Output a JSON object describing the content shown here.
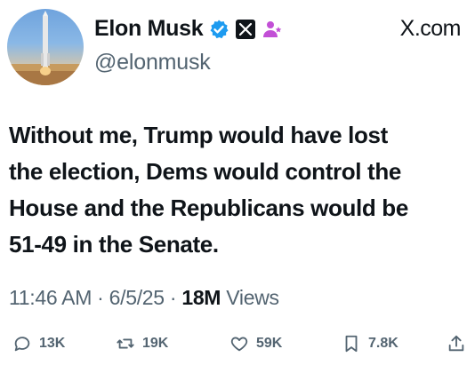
{
  "profile": {
    "display_name": "Elon Musk",
    "handle": "@elonmusk",
    "brand": "X.com"
  },
  "tweet": {
    "lines": [
      "Without me, Trump would have lost",
      "the election, Dems would control the",
      "House and the Republicans would be",
      "51-49 in the Senate."
    ]
  },
  "meta": {
    "time": "11:46 AM",
    "separator": "·",
    "date": "6/5/25",
    "views_count": "18M",
    "views_label": "Views"
  },
  "actions": {
    "replies": "13K",
    "reposts": "19K",
    "likes": "59K",
    "bookmarks": "7.8K"
  },
  "colors": {
    "verified": "#1d9bf0",
    "affiliate": "#c24fd6",
    "muted": "#536471",
    "text": "#0f1419"
  },
  "icons": [
    "verified-badge-icon",
    "x-logo-badge-icon",
    "affiliate-icon",
    "reply-icon",
    "repost-icon",
    "like-icon",
    "bookmark-icon",
    "share-icon"
  ]
}
